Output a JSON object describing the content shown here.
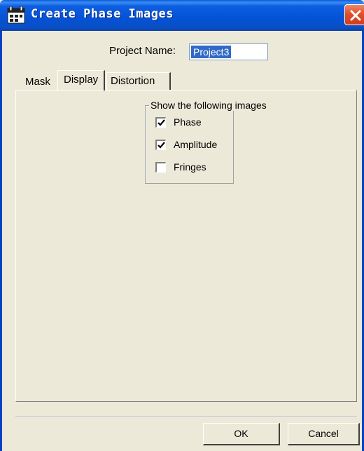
{
  "window": {
    "title": "Create Phase Images",
    "title_icon": "app-window-icon",
    "close_icon": "close-icon",
    "colors": {
      "titlebar": "#0452d6",
      "close": "#e0502a",
      "face": "#ece9d8",
      "selection": "#316ac5"
    }
  },
  "project": {
    "label": "Project Name:",
    "value": "Project3"
  },
  "tabs": [
    {
      "label": "Mask",
      "selected": false
    },
    {
      "label": "Display",
      "selected": true
    },
    {
      "label": "Distortion",
      "selected": false
    }
  ],
  "display": {
    "group_title": "Show the following images",
    "options": [
      {
        "label": "Phase",
        "checked": true
      },
      {
        "label": "Amplitude",
        "checked": true
      },
      {
        "label": "Fringes",
        "checked": false
      }
    ]
  },
  "buttons": {
    "ok": "OK",
    "cancel": "Cancel"
  }
}
